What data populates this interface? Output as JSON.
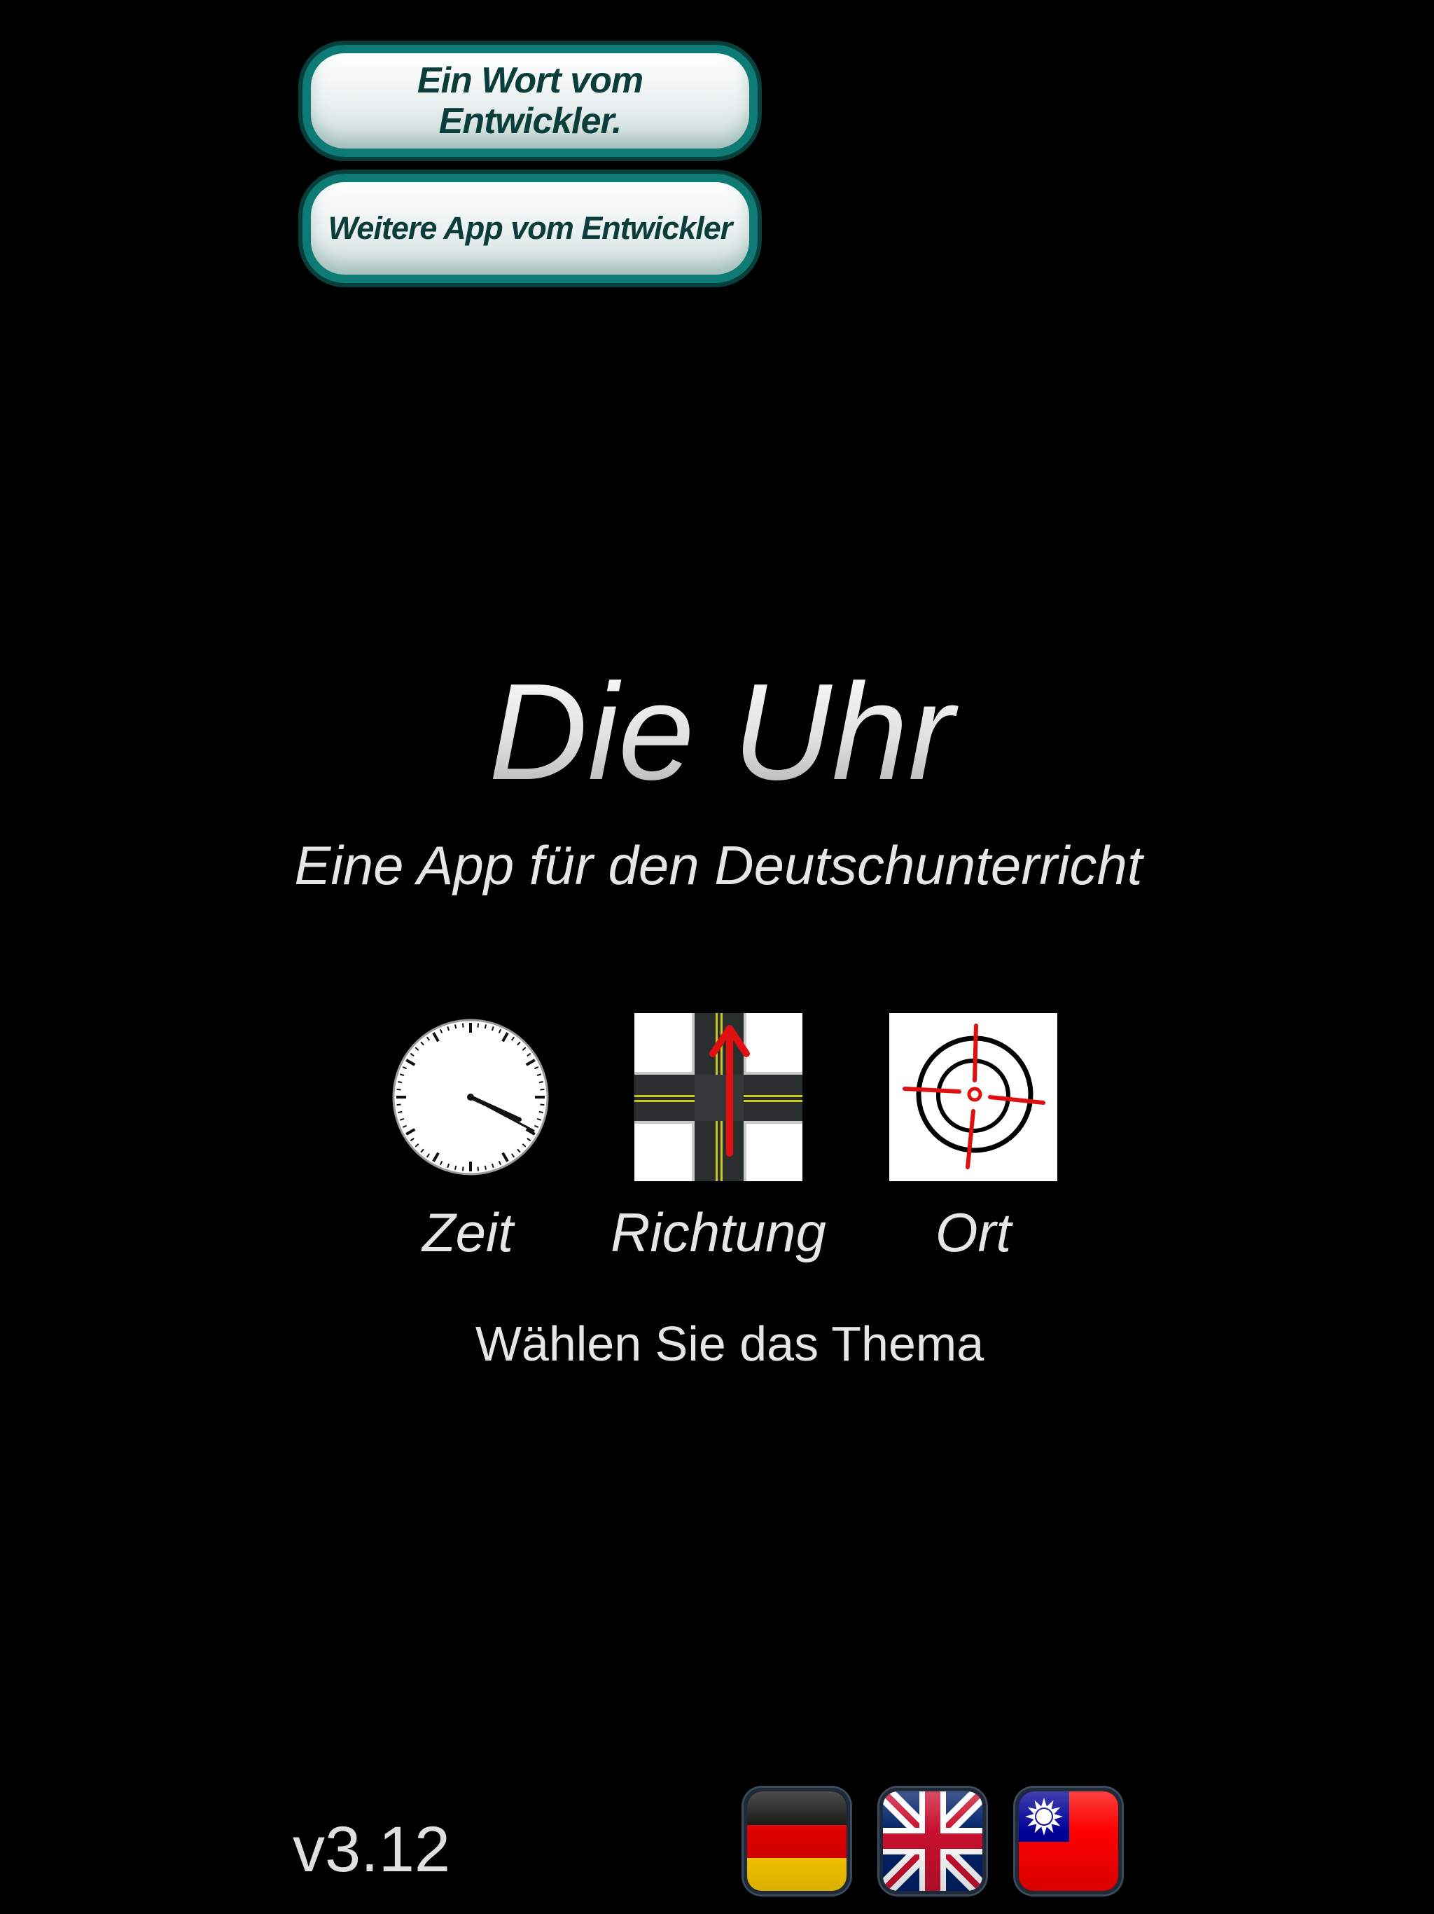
{
  "header": {
    "developer_word_button": "Ein Wort vom Entwickler.",
    "more_apps_button": "Weitere App vom Entwickler"
  },
  "main": {
    "title": "Die Uhr",
    "subtitle": "Eine App für den Deutschunterricht",
    "topics": [
      {
        "label": "Zeit",
        "icon": "clock-icon"
      },
      {
        "label": "Richtung",
        "icon": "crossroad-arrow-icon"
      },
      {
        "label": "Ort",
        "icon": "target-crosshair-icon"
      }
    ],
    "instruction": "Wählen Sie das Thema"
  },
  "footer": {
    "version": "v3.12",
    "languages": [
      {
        "name": "german-flag-icon",
        "code": "de"
      },
      {
        "name": "uk-flag-icon",
        "code": "en"
      },
      {
        "name": "taiwan-flag-icon",
        "code": "zh-TW"
      }
    ]
  },
  "colors": {
    "background": "#000000",
    "button_border": "#0d7b74",
    "button_text": "#0b3d3a",
    "text": "#e6e6e6",
    "arrow_red": "#e01010"
  }
}
